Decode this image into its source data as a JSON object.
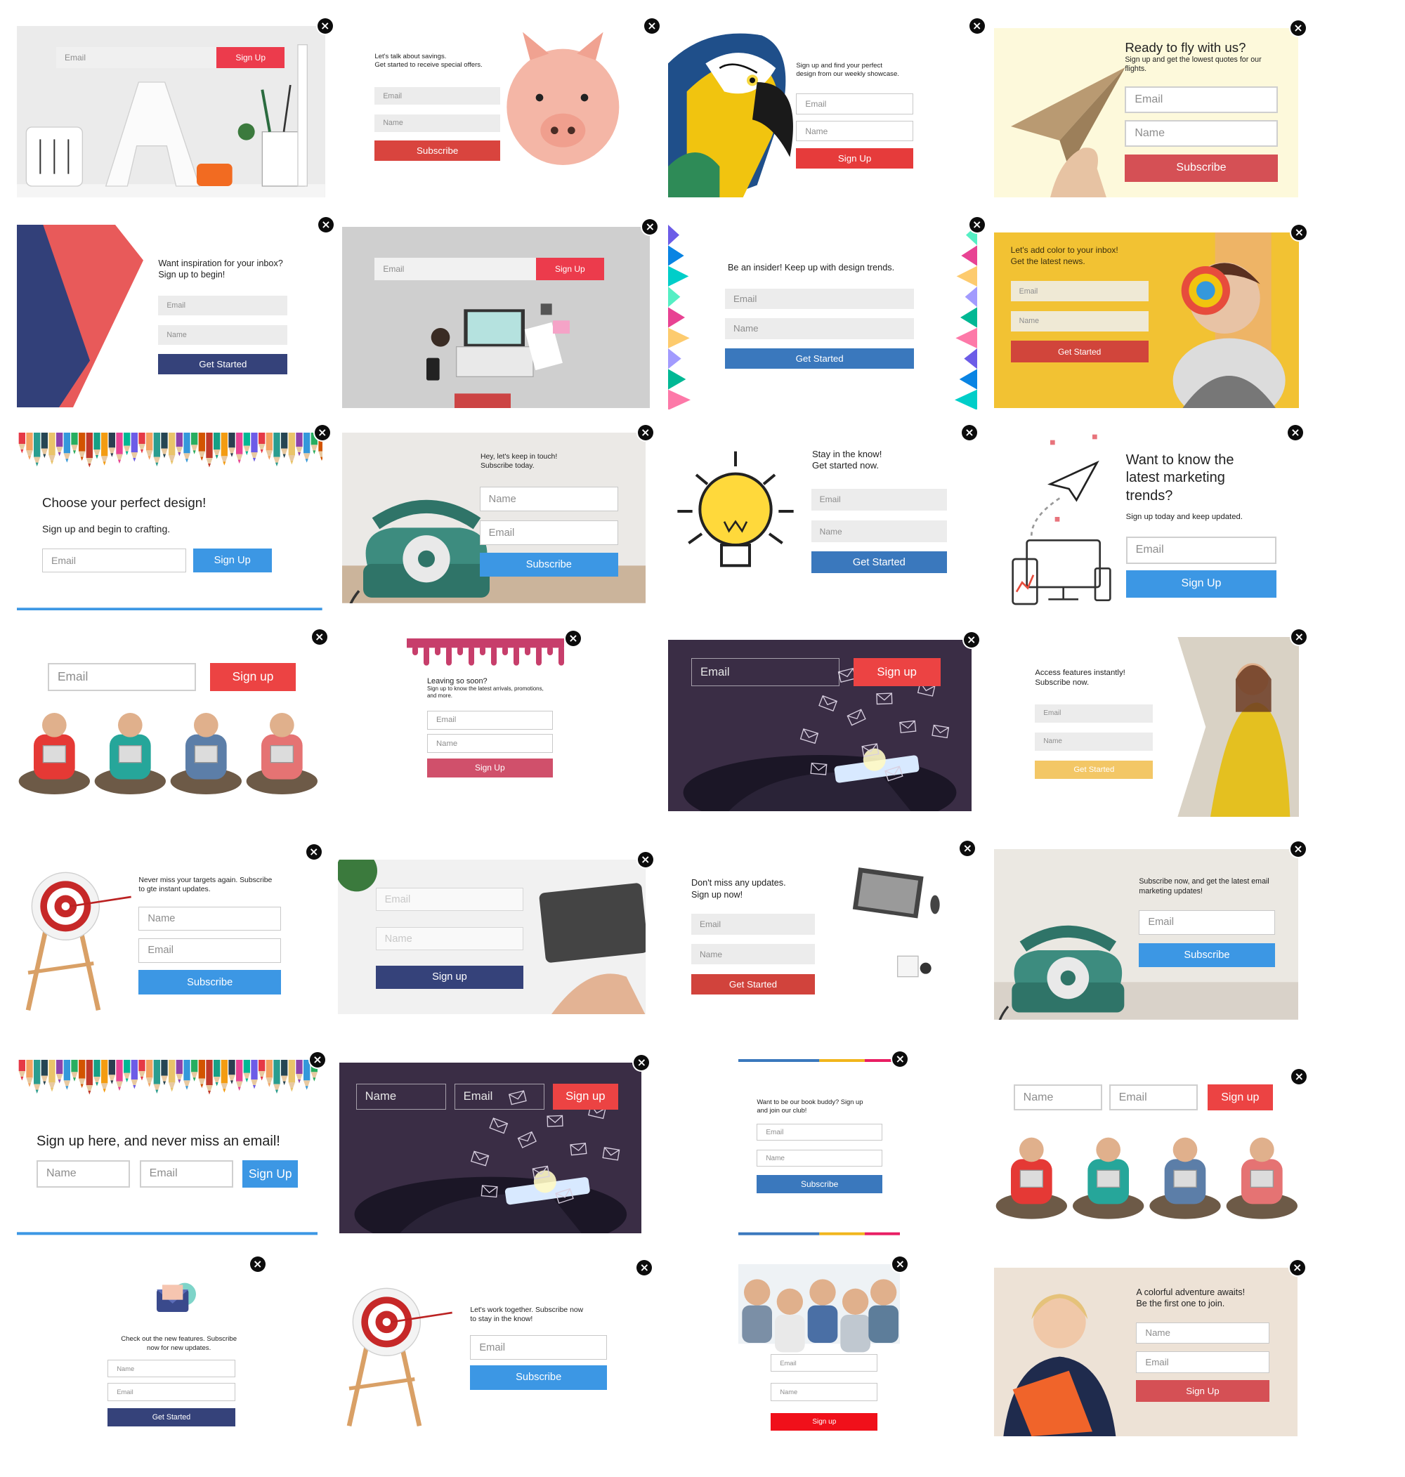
{
  "colors": {
    "close_bg": "#0c0c0c",
    "red": "#d9443e",
    "red_bright": "#ec3b4c",
    "blue": "#3c97e4",
    "navy": "#35427a",
    "yellow": "#f3c766",
    "pink": "#d0506b",
    "field_grey": "#ececec"
  },
  "close_glyph": "×",
  "icons": {
    "close": "close-icon",
    "piggy": "piggy-bank-icon",
    "paper_plane": "paper-plane-icon",
    "lightbulb": "lightbulb-icon",
    "target": "target-icon",
    "envelope": "envelope-icon",
    "devices": "devices-icon"
  },
  "cards": [
    {
      "id": "c01",
      "scene": "desk-letter-a",
      "fields": [
        {
          "label": "Email"
        }
      ],
      "button": "Sign Up",
      "texts": []
    },
    {
      "id": "c02",
      "scene": "piggy-bank",
      "texts": [
        "Let's talk about savings.\nGet started to receive special offers."
      ],
      "fields": [
        {
          "label": "Email"
        },
        {
          "label": "Name"
        }
      ],
      "button": "Subscribe"
    },
    {
      "id": "c03",
      "scene": "macaw-parrot",
      "texts": [
        "Sign up and find your perfect\ndesign from our weekly showcase."
      ],
      "fields": [
        {
          "label": "Email"
        },
        {
          "label": "Name"
        }
      ],
      "button": "Sign Up"
    },
    {
      "id": "c04",
      "scene": "paper-plane",
      "texts": [
        "Ready to fly with us?",
        "Sign up and get the lowest quotes for our\nflights."
      ],
      "fields": [
        {
          "label": "Email"
        },
        {
          "label": "Name"
        }
      ],
      "button": "Subscribe"
    },
    {
      "id": "c05",
      "scene": "geometric-shapes",
      "texts": [
        "Want inspiration for your inbox?\nSign up to begin!"
      ],
      "fields": [
        {
          "label": "Email"
        },
        {
          "label": "Name"
        }
      ],
      "button": "Get Started"
    },
    {
      "id": "c06",
      "scene": "laptop-workspace",
      "fields": [
        {
          "label": "Email"
        }
      ],
      "button": "Sign Up",
      "texts": []
    },
    {
      "id": "c07",
      "scene": "polygon-edges",
      "texts": [
        "Be an insider! Keep up with design trends."
      ],
      "fields": [
        {
          "label": "Email"
        },
        {
          "label": "Name"
        }
      ],
      "button": "Get Started"
    },
    {
      "id": "c08",
      "scene": "girl-lollipop",
      "texts": [
        "Let's add color to your inbox!\nGet the latest news."
      ],
      "fields": [
        {
          "label": "Email"
        },
        {
          "label": "Name"
        }
      ],
      "button": "Get Started"
    },
    {
      "id": "c09",
      "scene": "pencils-top",
      "texts": [
        "Choose your perfect design!",
        "Sign up and begin to crafting."
      ],
      "fields": [
        {
          "label": "Email"
        }
      ],
      "button": "Sign Up"
    },
    {
      "id": "c10",
      "scene": "rotary-phone",
      "texts": [
        "Hey, let's keep in touch!\nSubscribe today."
      ],
      "fields": [
        {
          "label": "Name"
        },
        {
          "label": "Email"
        }
      ],
      "button": "Subscribe"
    },
    {
      "id": "c11",
      "scene": "lightbulb",
      "texts": [
        "Stay in the know!\nGet started now."
      ],
      "fields": [
        {
          "label": "Email"
        },
        {
          "label": "Name"
        }
      ],
      "button": "Get Started"
    },
    {
      "id": "c12",
      "scene": "devices-illustration",
      "texts": [
        "Want to know the\nlatest marketing\ntrends?",
        "Sign up today and keep updated."
      ],
      "fields": [
        {
          "label": "Email"
        }
      ],
      "button": "Sign Up"
    },
    {
      "id": "c13",
      "scene": "people-tablets",
      "fields": [
        {
          "label": "Email"
        }
      ],
      "button": "Sign up",
      "texts": []
    },
    {
      "id": "c14",
      "scene": "paint-drips",
      "texts": [
        "Leaving so soon?",
        "Sign up to know the latest arrivals, promotions,\nand more."
      ],
      "fields": [
        {
          "label": "Email"
        },
        {
          "label": "Name"
        }
      ],
      "button": "Sign Up"
    },
    {
      "id": "c15",
      "scene": "hand-envelopes",
      "fields": [
        {
          "label": "Email"
        }
      ],
      "button": "Sign up",
      "texts": []
    },
    {
      "id": "c16",
      "scene": "woman-yellow-coat",
      "texts": [
        "Access features instantly!\nSubscribe now."
      ],
      "fields": [
        {
          "label": "Email"
        },
        {
          "label": "Name"
        }
      ],
      "button": "Get Started"
    },
    {
      "id": "c17",
      "scene": "target-easel",
      "texts": [
        "Never miss your targets again. Subscribe\nto gte instant updates."
      ],
      "fields": [
        {
          "label": "Name"
        },
        {
          "label": "Email"
        }
      ],
      "button": "Subscribe"
    },
    {
      "id": "c18",
      "scene": "keyboard-hands",
      "fields": [
        {
          "label": "Email"
        },
        {
          "label": "Name"
        }
      ],
      "button": "Sign up",
      "texts": []
    },
    {
      "id": "c19",
      "scene": "monitor-desk",
      "texts": [
        "Don't miss any updates.\nSign up now!"
      ],
      "fields": [
        {
          "label": "Email"
        },
        {
          "label": "Name"
        }
      ],
      "button": "Get Started"
    },
    {
      "id": "c20",
      "scene": "rotary-phone-wide",
      "texts": [
        "Subscribe now, and get the latest email\nmarketing updates!"
      ],
      "fields": [
        {
          "label": "Email"
        }
      ],
      "button": "Subscribe"
    },
    {
      "id": "c21",
      "scene": "pencils-top",
      "texts": [
        "Sign up here, and never miss an email!"
      ],
      "fields": [
        {
          "label": "Name"
        },
        {
          "label": "Email"
        }
      ],
      "button": "Sign Up"
    },
    {
      "id": "c22",
      "scene": "hand-envelopes",
      "fields": [
        {
          "label": "Name"
        },
        {
          "label": "Email"
        }
      ],
      "button": "Sign up",
      "texts": []
    },
    {
      "id": "c23",
      "scene": "color-bars",
      "texts": [
        "Want to be our book buddy? Sign up\nand join our club!"
      ],
      "fields": [
        {
          "label": "Email"
        },
        {
          "label": "Name"
        }
      ],
      "button": "Subscribe"
    },
    {
      "id": "c24",
      "scene": "people-tablets",
      "fields": [
        {
          "label": "Name"
        },
        {
          "label": "Email"
        }
      ],
      "button": "Sign up",
      "texts": []
    },
    {
      "id": "c25",
      "scene": "envelope-icon",
      "texts": [
        "Check out the new features. Subscribe\nnow for new updates."
      ],
      "fields": [
        {
          "label": "Name"
        },
        {
          "label": "Email"
        }
      ],
      "button": "Get Started"
    },
    {
      "id": "c26",
      "scene": "target-easel",
      "texts": [
        "Let's work together. Subscribe now\nto stay in the know!"
      ],
      "fields": [
        {
          "label": "Email"
        }
      ],
      "button": "Subscribe"
    },
    {
      "id": "c27",
      "scene": "group-photo",
      "fields": [
        {
          "label": "Email"
        },
        {
          "label": "Name"
        }
      ],
      "button": "Sign up",
      "texts": []
    },
    {
      "id": "c28",
      "scene": "woman-orange-folder",
      "texts": [
        "A colorful adventure awaits!\nBe the first one to join."
      ],
      "fields": [
        {
          "label": "Name"
        },
        {
          "label": "Email"
        }
      ],
      "button": "Sign Up"
    }
  ]
}
